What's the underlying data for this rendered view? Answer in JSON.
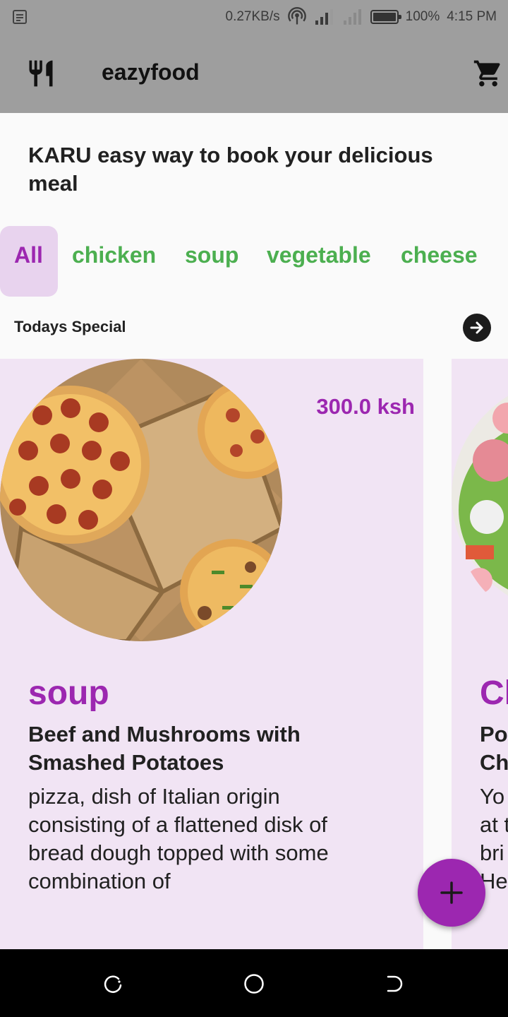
{
  "status_bar": {
    "speed": "0.27KB/s",
    "battery": "100%",
    "time": "4:15 PM",
    "icons": [
      "notification-icon",
      "hotspot-icon",
      "signal-icon",
      "signal-4g-icon",
      "battery-icon"
    ]
  },
  "app_bar": {
    "title": "eazyfood",
    "menu_icon": "restaurant-icon",
    "cart_icon": "shopping-cart-icon",
    "background": "#9e9e9e"
  },
  "headline": "KARU easy way to book your delicious meal",
  "categories": {
    "items": [
      "All",
      "chicken",
      "soup",
      "vegetable",
      "cheese",
      ""
    ],
    "selected": "All",
    "active_color": "#9c27b0",
    "active_background": "#e8d3ee",
    "inactive_color": "#4caf50"
  },
  "section": {
    "title": "Todays Special",
    "action_icon": "arrow-forward-icon"
  },
  "cards": [
    {
      "price": "300.0 ksh",
      "category": "soup",
      "name": "Beef and Mushrooms with Smashed Potatoes",
      "description": "pizza, dish of Italian origin consisting of a flattened disk of bread dough topped with some combination of",
      "image": "pizza-photo"
    },
    {
      "category": "Cl",
      "name_lines": [
        "Po",
        "Ch"
      ],
      "description_lines": [
        "Yo",
        "at t",
        "bri",
        "He"
      ],
      "image": "salad-photo"
    }
  ],
  "fab": {
    "icon": "plus-icon",
    "color": "#9c27b0"
  },
  "nav_bar": {
    "icons": [
      "recent-apps-icon",
      "home-icon",
      "back-icon"
    ]
  }
}
